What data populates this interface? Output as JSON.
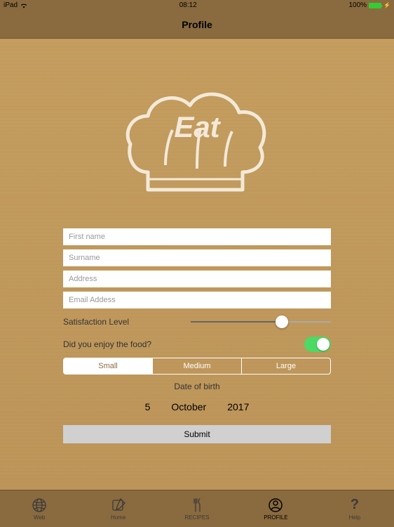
{
  "status": {
    "device": "iPad",
    "time": "08:12",
    "battery": "100%"
  },
  "nav": {
    "title": "Profile"
  },
  "logo": {
    "text": "Eat"
  },
  "form": {
    "first_name_placeholder": "First name",
    "surname_placeholder": "Surname",
    "address_placeholder": "Address",
    "email_placeholder": "Email Addess",
    "satisfaction_label": "Satisfaction Level",
    "satisfaction_value": 65,
    "enjoy_label": "Did you enjoy the food?",
    "enjoy_toggle": true,
    "segments": {
      "small": "Small",
      "medium": "Medium",
      "large": "Large",
      "selected": "Small"
    },
    "dob_label": "Date of birth",
    "dob": {
      "day": "5",
      "month": "October",
      "year": "2017"
    },
    "submit_label": "Submit"
  },
  "tabs": {
    "web": "Web",
    "home": "Home",
    "recipes": "RECIPES",
    "profile": "PROFILE",
    "help": "Help"
  }
}
